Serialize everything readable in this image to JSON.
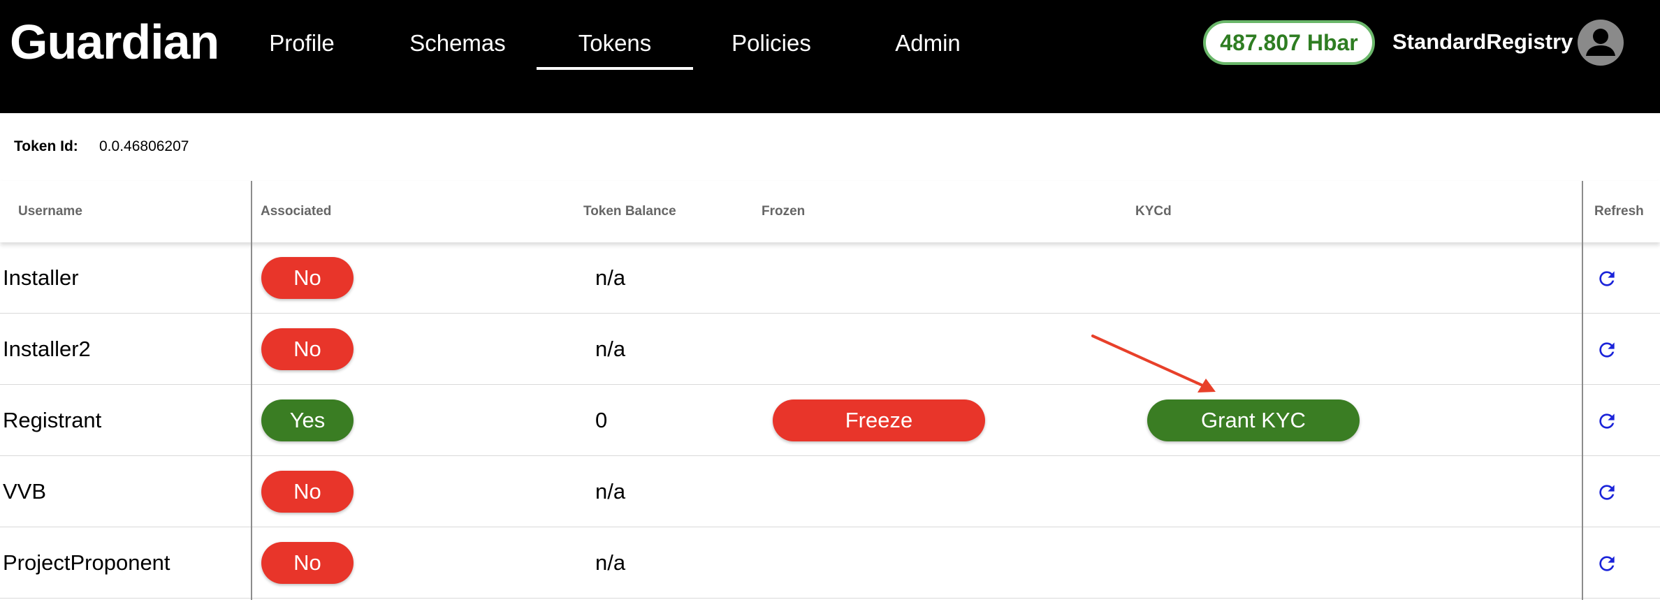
{
  "header": {
    "logo": "Guardian",
    "nav": [
      {
        "label": "Profile"
      },
      {
        "label": "Schemas"
      },
      {
        "label": "Tokens",
        "active": true
      },
      {
        "label": "Policies"
      },
      {
        "label": "Admin"
      }
    ],
    "balance": "487.807 Hbar",
    "username": "StandardRegistry",
    "avatar_icon": "account-circle-icon"
  },
  "token": {
    "label": "Token Id:",
    "value": "0.0.46806207"
  },
  "table": {
    "columns": [
      "Username",
      "Associated",
      "Token Balance",
      "Frozen",
      "KYCd",
      "Refresh"
    ],
    "rows": [
      {
        "username": "Installer",
        "associated": "No",
        "balance": "n/a"
      },
      {
        "username": "Installer2",
        "associated": "No",
        "balance": "n/a"
      },
      {
        "username": "Registrant",
        "associated": "Yes",
        "balance": "0",
        "frozen_action": "Freeze",
        "kyc_action": "Grant KYC"
      },
      {
        "username": "VVB",
        "associated": "No",
        "balance": "n/a"
      },
      {
        "username": "ProjectProponent",
        "associated": "No",
        "balance": "n/a"
      }
    ]
  },
  "colors": {
    "header_bg": "#000000",
    "no_pill": "#e8352a",
    "yes_pill": "#3a7d23",
    "hbar_text": "#2e7d22",
    "refresh_icon": "#1a23d9",
    "annotation_arrow": "#e8402a"
  },
  "icons": {
    "refresh": "refresh-icon",
    "annotation": "arrow-annotation"
  }
}
